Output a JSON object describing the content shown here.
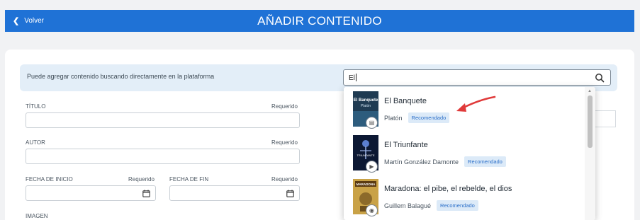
{
  "header": {
    "back_label": "Volver",
    "title": "AÑADIR CONTENIDO"
  },
  "info": {
    "text": "Puede agregar contenido buscando directamente en la plataforma"
  },
  "search": {
    "value": "El"
  },
  "form": {
    "title_label": "TÍTULO",
    "author_label": "AUTOR",
    "start_label": "FECHA DE INICIO",
    "end_label": "FECHA DE FIN",
    "image_label": "IMAGEN",
    "required": "Requerido"
  },
  "results": [
    {
      "title": "El Banquete",
      "author": "Platón",
      "tag": "Recomendado",
      "type_icon": "document-icon",
      "cover_text": "El Banquete Platón"
    },
    {
      "title": "El Triunfante",
      "author": "Martín González Damonte",
      "tag": "Recomendado",
      "type_icon": "video-icon",
      "cover_text": "TRIUNFANTE"
    },
    {
      "title": "Maradona: el pibe, el rebelde, el dios",
      "author": "Guillem Balagué",
      "tag": "Recomendado",
      "type_icon": "headphones-icon",
      "cover_text": "MARADONA"
    }
  ],
  "colors": {
    "header": "#1f72d6",
    "info_bg": "#e3eef8",
    "tag_bg": "#dceaf8",
    "arrow": "#e03a3a"
  }
}
